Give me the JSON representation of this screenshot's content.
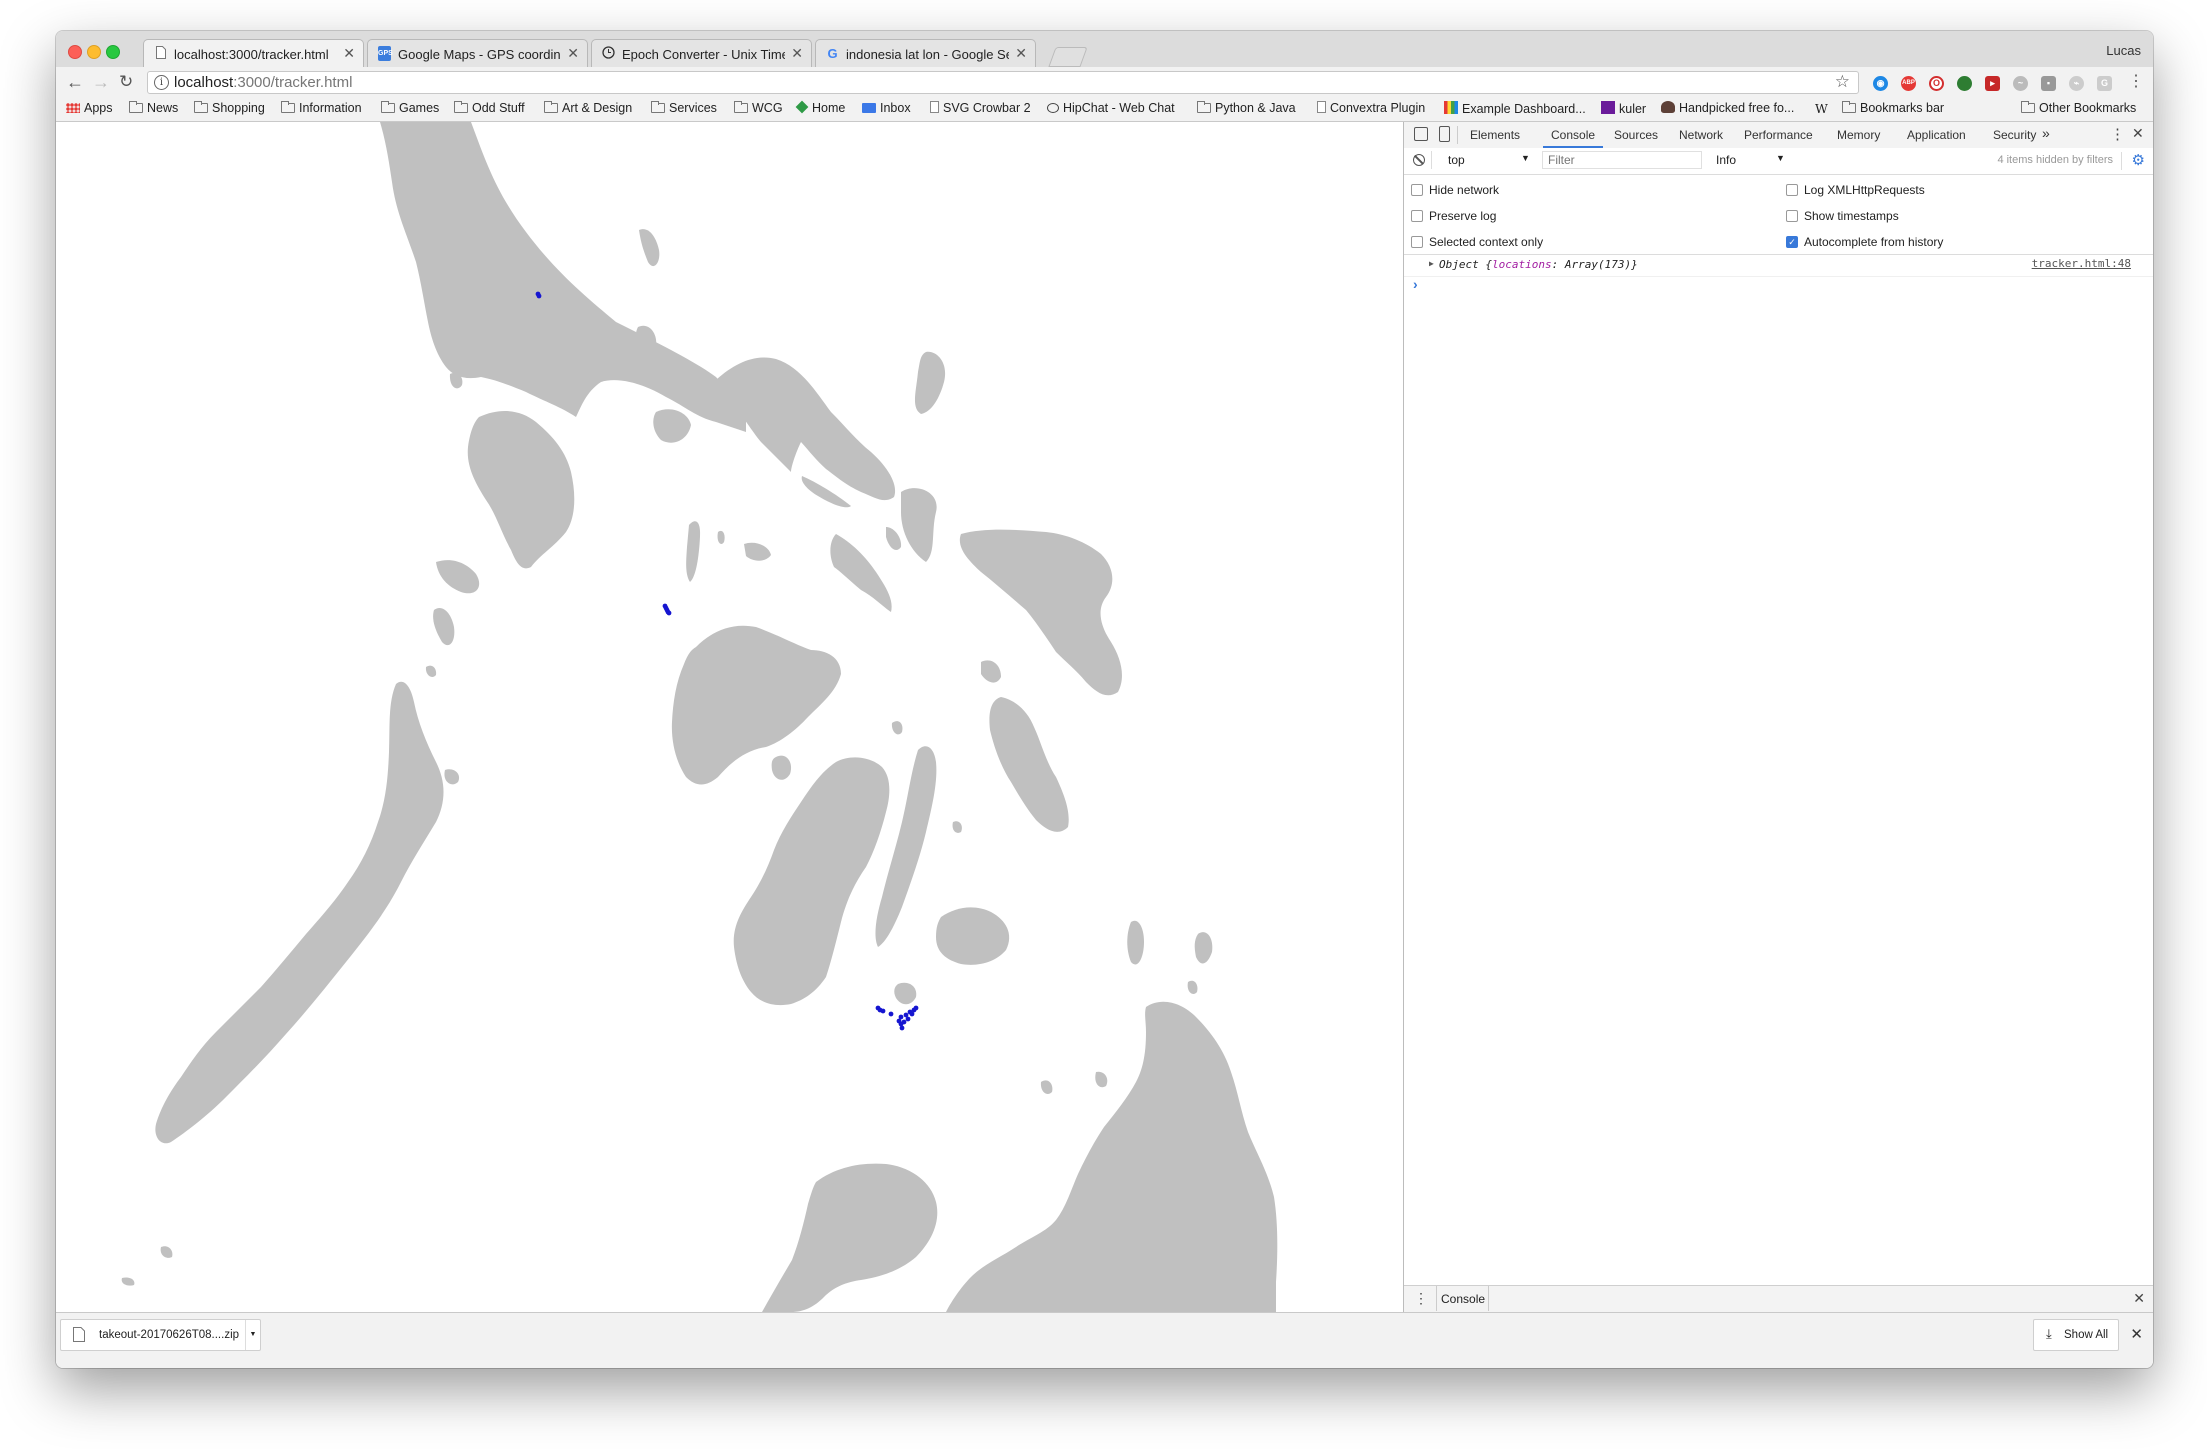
{
  "browser": {
    "user_name": "Lucas",
    "tabs": [
      {
        "title": "localhost:3000/tracker.html",
        "icon": "page-icon",
        "active": true
      },
      {
        "title": "Google Maps - GPS coordinates",
        "icon": "gps-icon",
        "active": false
      },
      {
        "title": "Epoch Converter - Unix Timestamp",
        "icon": "clock-icon",
        "active": false
      },
      {
        "title": "indonesia lat lon - Google Search",
        "icon": "google-icon",
        "active": false
      }
    ],
    "address_host": "localhost",
    "address_path": ":3000/tracker.html",
    "bookmarks": [
      "Apps",
      "News",
      "Shopping",
      "Information",
      "Games",
      "Odd Stuff",
      "Art & Design",
      "Services",
      "WCG",
      "Home",
      "Inbox",
      "SVG Crowbar 2",
      "HipChat - Web Chat",
      "Python & Java",
      "Convextra Plugin",
      "Example Dashboard...",
      "kuler",
      "Handpicked free fo...",
      "W",
      "Bookmarks bar",
      "Other Bookmarks"
    ]
  },
  "devtools": {
    "tabs": [
      "Elements",
      "Console",
      "Sources",
      "Network",
      "Performance",
      "Memory",
      "Application",
      "Security"
    ],
    "active_tab": "Console",
    "more_symbol": "»",
    "context": "top",
    "filter_placeholder": "Filter",
    "level": "Info",
    "hidden_count_text": "4 items hidden by filters",
    "settings_left": [
      {
        "label": "Hide network",
        "checked": false
      },
      {
        "label": "Preserve log",
        "checked": false
      },
      {
        "label": "Selected context only",
        "checked": false
      }
    ],
    "settings_right": [
      {
        "label": "Log XMLHttpRequests",
        "checked": false
      },
      {
        "label": "Show timestamps",
        "checked": false
      },
      {
        "label": "Autocomplete from history",
        "checked": true
      }
    ],
    "log": {
      "prefix": "Object {",
      "key": "locations",
      "value": ": Array(173)}",
      "source": "tracker.html:48"
    },
    "prompt": "›",
    "drawer_tab": "Console"
  },
  "downloads": {
    "file_name": "takeout-20170626T08....zip",
    "show_all": "Show All"
  },
  "map": {
    "land_color": "#c0c0c0",
    "track_color": "#1515d0"
  }
}
